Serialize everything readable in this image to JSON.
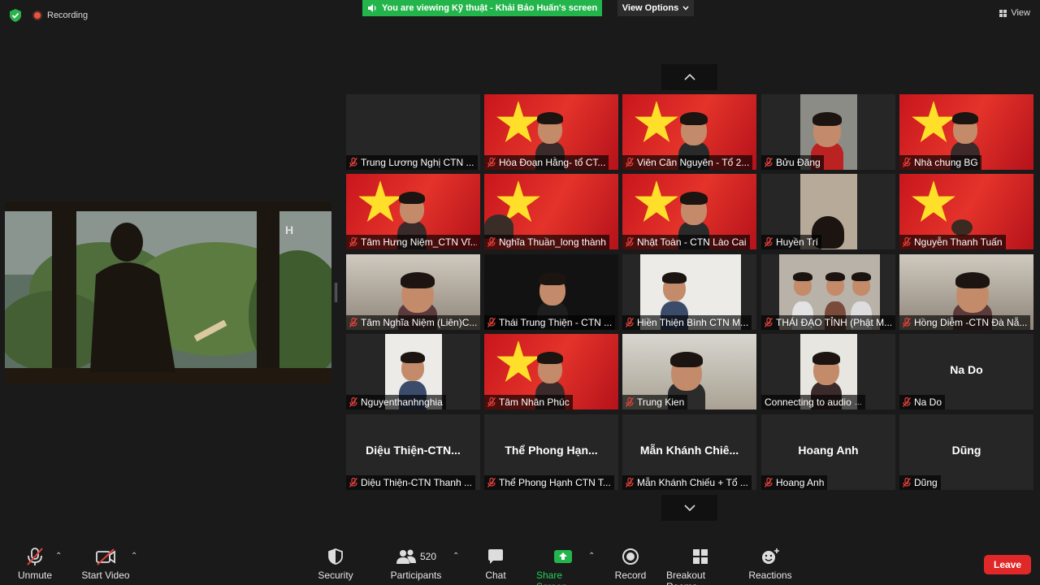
{
  "topbar": {
    "recording_label": "Recording",
    "banner_text": "You are viewing Kỹ thuật - Khải Bảo Huấn's screen",
    "view_options_label": "View Options",
    "view_label": "View"
  },
  "tiles": [
    {
      "name": "Trung Lương Nghị CTN ..."
    },
    {
      "name": "Hòa Đoạn Hằng- tổ CT..."
    },
    {
      "name": "Viên Căn Nguyên - Tổ 2..."
    },
    {
      "name": "Bửu Đăng"
    },
    {
      "name": "Nhà chung BG"
    },
    {
      "name": "Tâm Hưng Niệm_CTN Vĩ..."
    },
    {
      "name": "Nghĩa Thuần_long thành"
    },
    {
      "name": "Nhật Toàn - CTN Lào Cai"
    },
    {
      "name": "Huyền Trí"
    },
    {
      "name": "Nguyễn Thanh Tuấn"
    },
    {
      "name": "Tâm Nghĩa Niệm (Liên)C..."
    },
    {
      "name": "Thái Trung Thiện - CTN ..."
    },
    {
      "name": "Hiền Thiện Bình CTN M..."
    },
    {
      "name": "THÁI ĐẠO TỈNH (Phật M..."
    },
    {
      "name": "Hồng Diễm -CTN Đà Nẵ..."
    },
    {
      "name": "Nguyenthanhnghia"
    },
    {
      "name": "Tâm Nhân Phúc"
    },
    {
      "name": "Trung Kien"
    },
    {
      "name": "Connecting to audio"
    },
    {
      "name": "Na Do",
      "big": "Na Do"
    },
    {
      "name": "Diệu Thiện-CTN Thanh ...",
      "big": "Diệu  Thiện-CTN..."
    },
    {
      "name": "Thể Phong Hạnh CTN T...",
      "big": "Thể  Phong  Hạn..."
    },
    {
      "name": "Mẫn Khánh Chiếu + Tổ ...",
      "big": "Mẫn  Khánh  Chiê..."
    },
    {
      "name": "Hoang Anh",
      "big": "Hoang Anh"
    },
    {
      "name": "Dũng",
      "big": "Dũng"
    }
  ],
  "toolbar": {
    "unmute": "Unmute",
    "start_video": "Start Video",
    "security": "Security",
    "participants": "Participants",
    "participant_count": "520",
    "chat": "Chat",
    "share_screen": "Share Screen",
    "record": "Record",
    "breakout_rooms": "Breakout Rooms",
    "reactions": "Reactions",
    "leave": "Leave"
  },
  "colors": {
    "accent_green": "#23b54b",
    "leave_red": "#e02828",
    "muted_mic_red": "#e2413a"
  }
}
